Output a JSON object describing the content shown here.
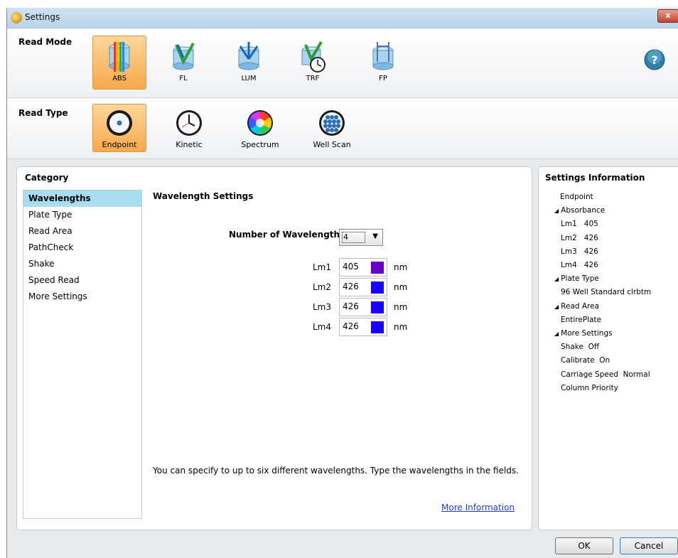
{
  "window": {
    "title": "Settings",
    "close_glyph": "x"
  },
  "read_mode": {
    "label": "Read Mode",
    "items": [
      {
        "label": "ABS",
        "icon": "absorbance-icon",
        "selected": true
      },
      {
        "label": "FL",
        "icon": "fluorescence-icon",
        "selected": false
      },
      {
        "label": "LUM",
        "icon": "luminescence-icon",
        "selected": false
      },
      {
        "label": "TRF",
        "icon": "time-resolved-fluorescence-icon",
        "selected": false
      },
      {
        "label": "FP",
        "icon": "fluorescence-polarization-icon",
        "selected": false
      }
    ],
    "help_glyph": "?"
  },
  "read_type": {
    "label": "Read Type",
    "items": [
      {
        "label": "Endpoint",
        "icon": "endpoint-icon",
        "selected": true
      },
      {
        "label": "Kinetic",
        "icon": "clock-icon",
        "selected": false
      },
      {
        "label": "Spectrum",
        "icon": "color-wheel-icon",
        "selected": false
      },
      {
        "label": "Well Scan",
        "icon": "well-grid-icon",
        "selected": false
      }
    ]
  },
  "category": {
    "title": "Category",
    "items": [
      "Wavelengths",
      "Plate Type",
      "Read Area",
      "PathCheck",
      "Shake",
      "Speed Read",
      "More Settings"
    ],
    "selected": "Wavelengths"
  },
  "wavelength_settings": {
    "title": "Wavelength Settings",
    "number_label": "Number of Wavelengths",
    "number_value": "4",
    "unit": "nm",
    "rows": [
      {
        "label": "Lm1",
        "value": "405",
        "color": "#6a00c8"
      },
      {
        "label": "Lm2",
        "value": "426",
        "color": "#1a00ff"
      },
      {
        "label": "Lm3",
        "value": "426",
        "color": "#1a00ff"
      },
      {
        "label": "Lm4",
        "value": "426",
        "color": "#1a00ff"
      }
    ],
    "hint": "You can specify to up to six different wavelengths. Type the wavelengths in the fields.",
    "more_info_link": "More Information"
  },
  "settings_information": {
    "title": "Settings Information",
    "lines": [
      "Endpoint",
      "Absorbance",
      "Lm1   405",
      "Lm2   426",
      "Lm3   426",
      "Lm4   426",
      "Plate Type",
      "96 Well Standard clrbtm",
      "Read Area",
      "EntirePlate",
      "More Settings",
      "Shake  Off",
      "Calibrate  On",
      "Carriage Speed  Normal",
      "Column Priority"
    ]
  },
  "footer": {
    "ok_label": "OK",
    "cancel_label": "Cancel"
  },
  "colors": {
    "selected_tool": "#f7a94b",
    "selected_category": "#a8dcef",
    "link": "#1a3fd6"
  }
}
